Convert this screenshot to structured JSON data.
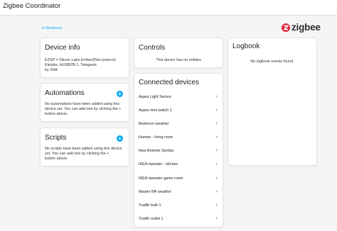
{
  "window": {
    "title": "Zigbee Coordinator"
  },
  "breadcrumb": "In Bedroom",
  "brand": {
    "logo_text": "zigbee",
    "color": "#e0263a"
  },
  "device_info": {
    "title": "Device info",
    "lines": [
      "EZSP = Silicon Labs EmberZNet protocol:",
      "Elelabs, HUSBZB-1, Telegesis",
      "by ZHA"
    ]
  },
  "automations": {
    "title": "Automations",
    "lines": [
      "No automations have been added using this",
      "device yet. You can add one by clicking the +",
      "button above."
    ],
    "add_icon": "plus-icon"
  },
  "scripts": {
    "title": "Scripts",
    "lines": [
      "No scripts have been added using this device",
      "yet. You can add one by clicking the +",
      "button above."
    ],
    "add_icon": "plus-icon"
  },
  "controls": {
    "title": "Controls",
    "empty": "This device has no entities"
  },
  "connected": {
    "title": "Connected devices",
    "devices": [
      "Aqara Light Sensor",
      "Aqara mini switch 1",
      "Bedroom weather",
      "Human - living room",
      "Ikea Remote Styrbar",
      "IKEA repeater - kitchen",
      "IKEA repeater game room",
      "Master BR weather",
      "Tradfri bulb 1",
      "Tradfri outlet 1"
    ]
  },
  "logbook": {
    "title": "Logbook",
    "empty": "No logbook events found."
  },
  "colors": {
    "accent": "#03a9f4"
  }
}
